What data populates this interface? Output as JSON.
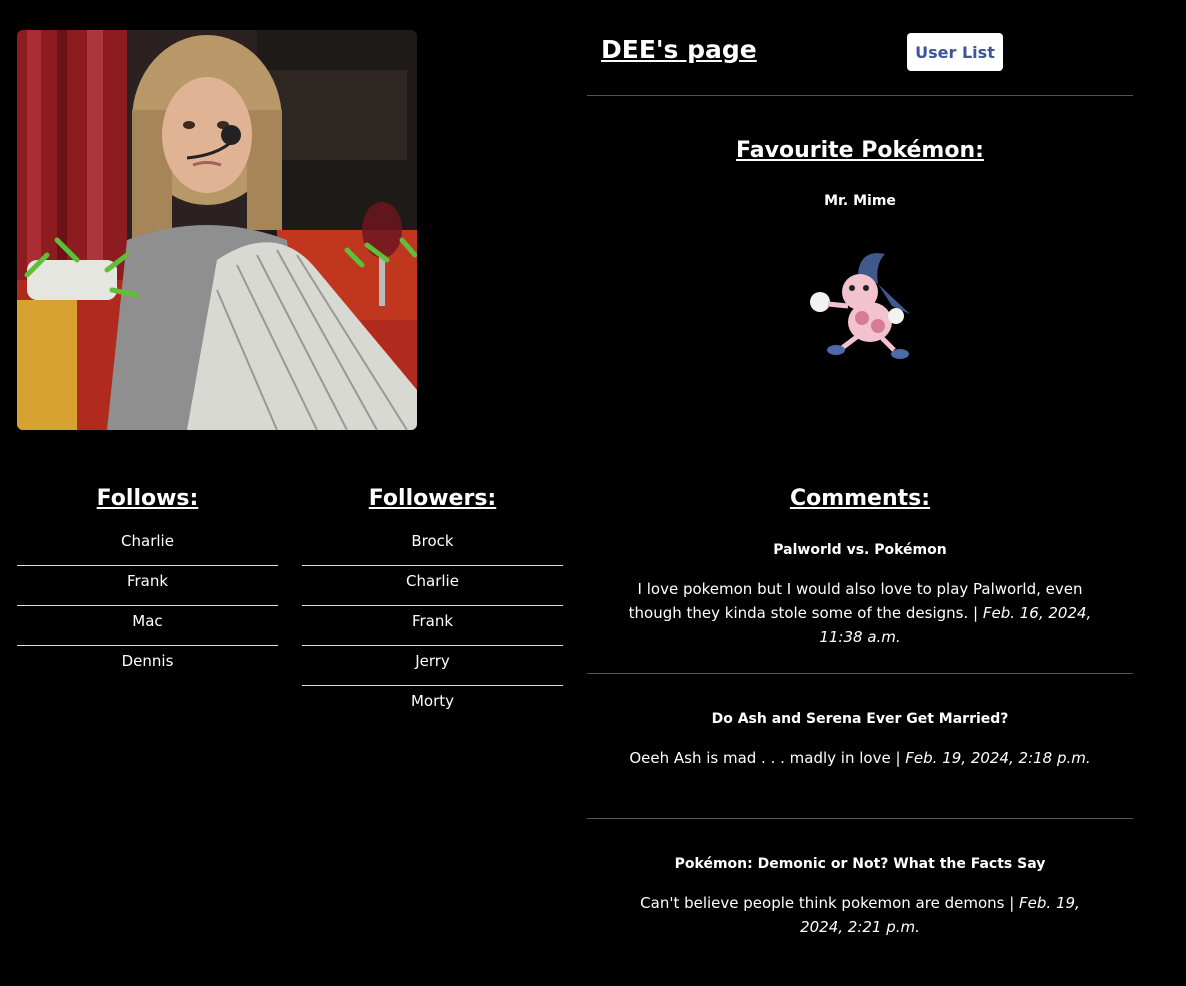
{
  "profile": {
    "page_title": "DEE's page",
    "photo_alt": "Profile photo"
  },
  "header": {
    "user_list_button": "User List"
  },
  "favourite": {
    "heading": "Favourite Pokémon:",
    "name": "Mr. Mime"
  },
  "follows": {
    "heading": "Follows:",
    "items": [
      "Charlie",
      "Frank",
      "Mac",
      "Dennis"
    ]
  },
  "followers": {
    "heading": "Followers:",
    "items": [
      "Brock",
      "Charlie",
      "Frank",
      "Jerry",
      "Morty"
    ]
  },
  "comments": {
    "heading": "Comments:",
    "items": [
      {
        "title": "Palworld vs. Pokémon",
        "body": "I love pokemon but I would also love to play Palworld, even though they kinda stole some of the designs.",
        "separator": " | ",
        "date": "Feb. 16, 2024, 11:38 a.m."
      },
      {
        "title": "Do Ash and Serena Ever Get Married?",
        "body": "Oeeh Ash is mad . . . madly in love",
        "separator": " | ",
        "date": "Feb. 19, 2024, 2:18 p.m."
      },
      {
        "title": "Pokémon: Demonic or Not? What the Facts Say",
        "body": "Can't believe people think pokemon are demons",
        "separator": " | ",
        "date": "Feb. 19, 2024, 2:21 p.m."
      }
    ]
  },
  "colors": {
    "background": "#000000",
    "text": "#ffffff",
    "button_bg": "#ffffff",
    "button_text": "#3b5598",
    "divider": "#555555"
  }
}
